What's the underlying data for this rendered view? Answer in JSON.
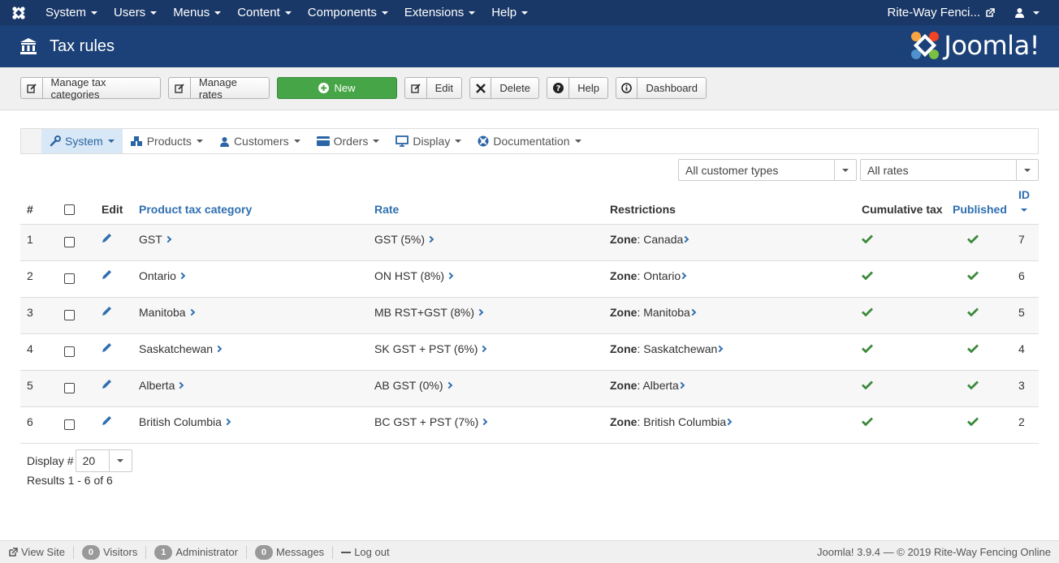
{
  "topnav": {
    "menus": [
      "System",
      "Users",
      "Menus",
      "Content",
      "Components",
      "Extensions",
      "Help"
    ],
    "site_name": "Rite-Way Fenci..."
  },
  "header": {
    "title": "Tax rules",
    "brand": "Joomla!"
  },
  "toolbar": {
    "manage_categories": "Manage tax categories",
    "manage_rates": "Manage rates",
    "new": "New",
    "edit": "Edit",
    "delete": "Delete",
    "help": "Help",
    "dashboard": "Dashboard"
  },
  "submenu": {
    "system": "System",
    "products": "Products",
    "customers": "Customers",
    "orders": "Orders",
    "display": "Display",
    "documentation": "Documentation"
  },
  "filters": {
    "customer_types": "All customer types",
    "rates": "All rates"
  },
  "table": {
    "headers": {
      "num": "#",
      "edit": "Edit",
      "category": "Product tax category",
      "rate": "Rate",
      "restrictions": "Restrictions",
      "cumulative": "Cumulative tax",
      "published": "Published",
      "id": "ID"
    },
    "zone_label": "Zone",
    "rows": [
      {
        "num": "1",
        "category": "GST",
        "rate": "GST (5%)",
        "zone": "Canada",
        "id": "7"
      },
      {
        "num": "2",
        "category": "Ontario",
        "rate": "ON HST (8%)",
        "zone": "Ontario",
        "id": "6"
      },
      {
        "num": "3",
        "category": "Manitoba",
        "rate": "MB RST+GST (8%)",
        "zone": "Manitoba",
        "id": "5"
      },
      {
        "num": "4",
        "category": "Saskatchewan",
        "rate": "SK GST + PST (6%)",
        "zone": "Saskatchewan",
        "id": "4"
      },
      {
        "num": "5",
        "category": "Alberta",
        "rate": "AB GST (0%)",
        "zone": "Alberta",
        "id": "3"
      },
      {
        "num": "6",
        "category": "British Columbia",
        "rate": "BC GST + PST (7%)",
        "zone": "British Columbia",
        "id": "2"
      }
    ]
  },
  "pagination": {
    "display_label": "Display #",
    "display_value": "20",
    "results": "Results 1 - 6 of 6"
  },
  "statusbar": {
    "view_site": "View Site",
    "visitors_count": "0",
    "visitors": "Visitors",
    "admin_count": "1",
    "admin": "Administrator",
    "messages_count": "0",
    "messages": "Messages",
    "logout": "Log out",
    "copyright": "Joomla! 3.9.4 — © 2019 Rite-Way Fencing Online"
  },
  "colors": {
    "navbar": "#1a3867",
    "header": "#1b4178",
    "success": "#46a546",
    "link": "#2f6fb0",
    "check": "#3c8a3c"
  }
}
